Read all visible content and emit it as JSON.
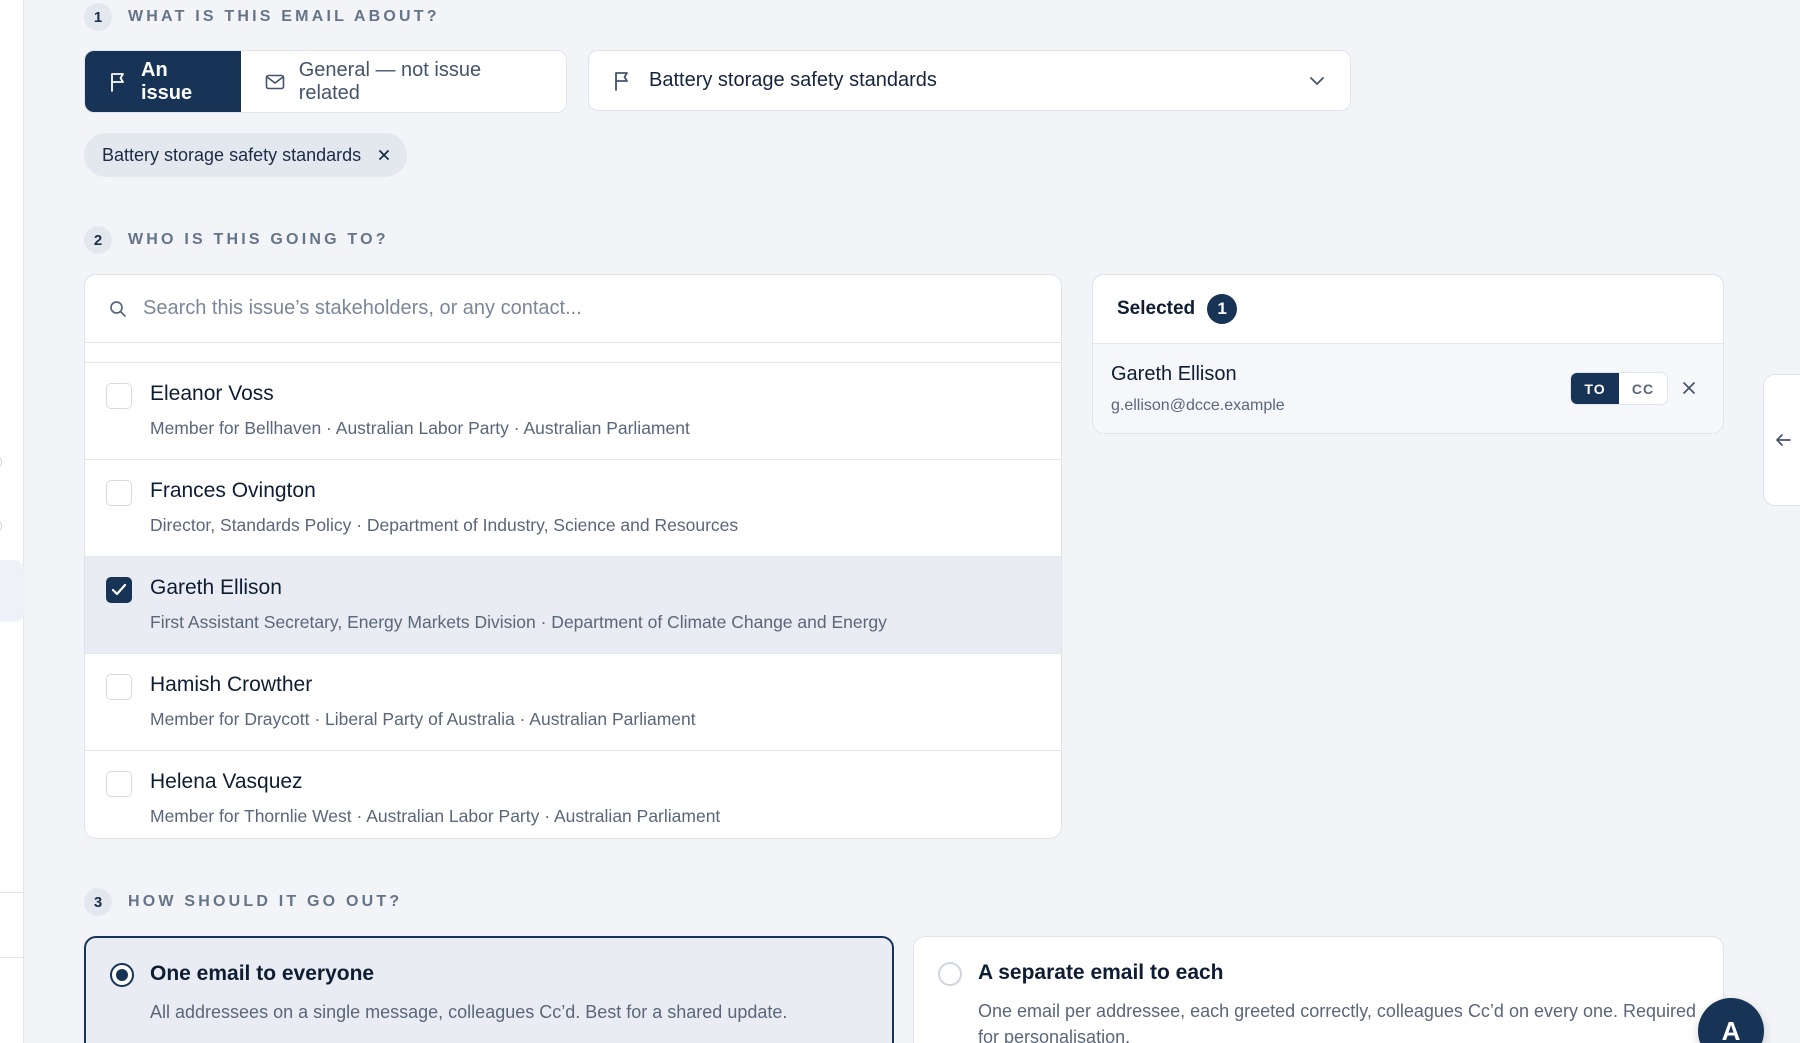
{
  "steps": {
    "s1": {
      "num": "1",
      "title": "WHAT IS THIS EMAIL ABOUT?"
    },
    "s2": {
      "num": "2",
      "title": "WHO IS THIS GOING TO?"
    },
    "s3": {
      "num": "3",
      "title": "HOW SHOULD IT GO OUT?"
    }
  },
  "about": {
    "mode_issue": "An issue",
    "mode_general": "General — not issue related",
    "selected_mode": "issue",
    "issue_value": "Battery storage safety standards",
    "chip_label": "Battery storage safety standards"
  },
  "recipients": {
    "search_placeholder": "Search this issue’s stakeholders, or any contact...",
    "contacts": [
      {
        "name": "Eleanor Voss",
        "meta": "Member for Bellhaven · Australian Labor Party · Australian Parliament",
        "checked": false
      },
      {
        "name": "Frances Ovington",
        "meta": "Director, Standards Policy · Department of Industry, Science and Resources",
        "checked": false
      },
      {
        "name": "Gareth Ellison",
        "meta": "First Assistant Secretary, Energy Markets Division · Department of Climate Change and Energy",
        "checked": true
      },
      {
        "name": "Hamish Crowther",
        "meta": "Member for Draycott · Liberal Party of Australia · Australian Parliament",
        "checked": false
      },
      {
        "name": "Helena Vasquez",
        "meta": "Member for Thornlie West · Australian Labor Party · Australian Parliament",
        "checked": false
      }
    ],
    "selected_title": "Selected",
    "selected_count": "1",
    "selected": [
      {
        "name": "Gareth Ellison",
        "email": "g.ellison@dcce.example",
        "to_label": "TO",
        "cc_label": "CC",
        "mode": "TO"
      }
    ]
  },
  "delivery": {
    "options": [
      {
        "title": "One email to everyone",
        "desc": "All addressees on a single message, colleagues Cc’d. Best for a shared update.",
        "selected": true
      },
      {
        "title": "A separate email to each",
        "desc": "One email per addressee, each greeted correctly, colleagues Cc’d on every one. Required for personalisation.",
        "selected": false
      }
    ]
  },
  "fab_label": "A",
  "colors": {
    "primary": "#173356",
    "background": "#f2f4f7",
    "muted_text": "#5a6679"
  }
}
